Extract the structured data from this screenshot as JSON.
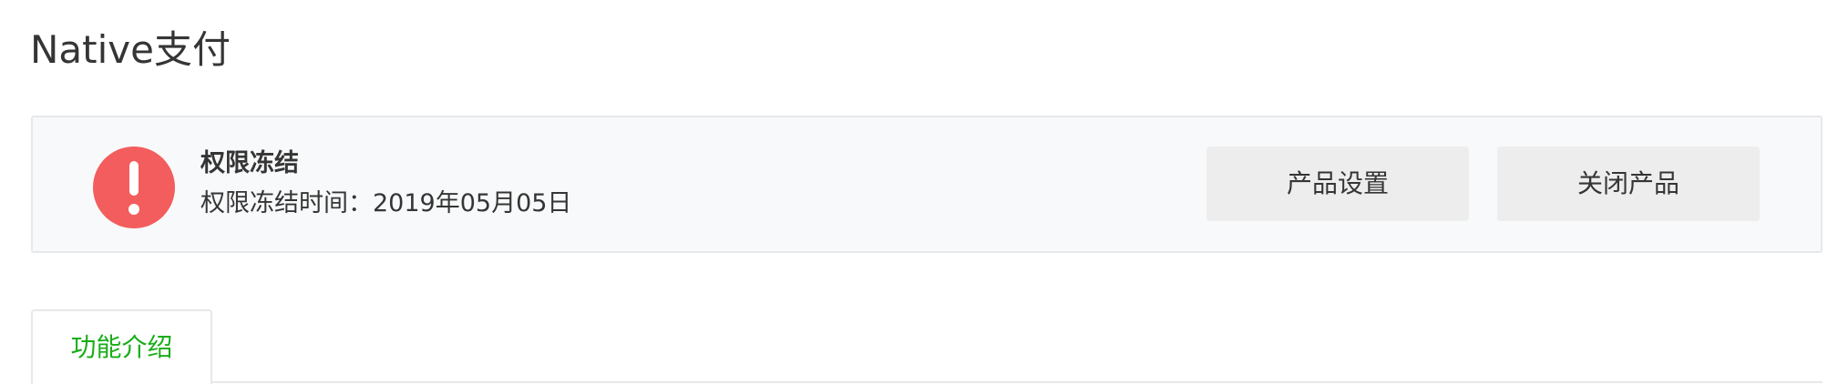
{
  "page": {
    "title": "Native支付"
  },
  "status_panel": {
    "icon": "exclamation-icon",
    "icon_color": "#f35d5d",
    "title": "权限冻结",
    "detail": "权限冻结时间：2019年05月05日",
    "buttons": {
      "settings_label": "产品设置",
      "close_label": "关闭产品"
    }
  },
  "tabs": [
    {
      "label": "功能介绍",
      "active": true
    }
  ],
  "colors": {
    "accent": "#1aad19",
    "panel_background": "#f8f9fa",
    "button_background": "#ededed",
    "text": "#353535"
  }
}
